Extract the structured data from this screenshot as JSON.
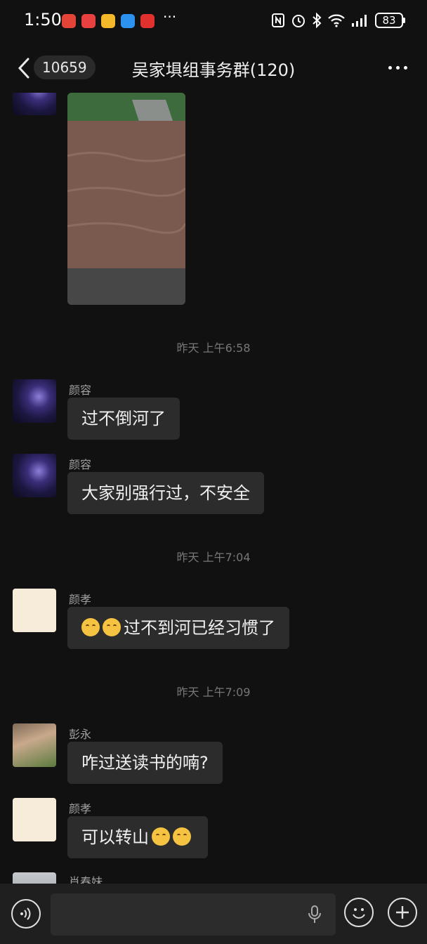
{
  "status_bar": {
    "time": "1:50",
    "more": "···",
    "battery": "83",
    "app_icon_colors": [
      "#e34437",
      "#e8413f",
      "#f4b92b",
      "#2b92f0",
      "#e0312f"
    ]
  },
  "header": {
    "unread_count": "10659",
    "title": "吴家埧组事务群(120)"
  },
  "messages": {
    "ts1": "昨天 上午6:58",
    "m1_sender": "颜容",
    "m1_text": "过不倒河了",
    "m2_sender": "颜容",
    "m2_text": "大家别强行过，不安全",
    "ts2": "昨天 上午7:04",
    "m3_sender": "颜孝",
    "m3_text": "过不到河已经习惯了",
    "ts3": "昨天 上午7:09",
    "m4_sender": "彭永",
    "m4_text": "咋过送读书的喃?",
    "m5_sender": "颜孝",
    "m5_text": "可以转山",
    "m6_sender": "肖春妹"
  },
  "colors": {
    "background": "#111111",
    "bubble": "#2c2c2c",
    "input_bar": "#1f1f1f"
  }
}
